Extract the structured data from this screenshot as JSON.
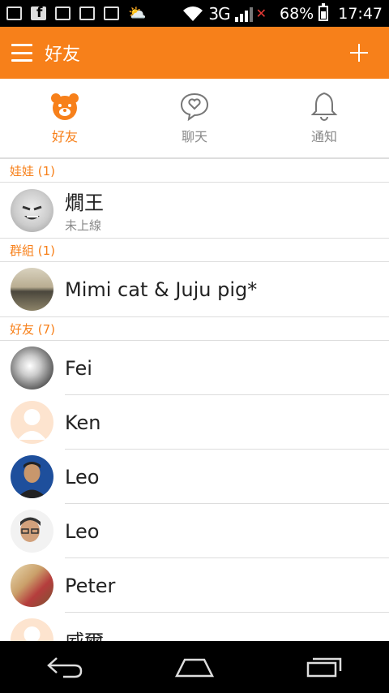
{
  "status_bar": {
    "network": "3G",
    "battery": "68%",
    "time": "17:47"
  },
  "app_bar": {
    "title": "好友"
  },
  "tabs": [
    {
      "label": "好友",
      "icon": "bear-icon",
      "active": true
    },
    {
      "label": "聊天",
      "icon": "chat-heart-icon",
      "active": false
    },
    {
      "label": "通知",
      "icon": "bell-icon",
      "active": false
    }
  ],
  "sections": {
    "babies": {
      "header": "娃娃 (1)",
      "items": [
        {
          "name": "燗王",
          "status": "未上線"
        }
      ]
    },
    "groups": {
      "header": "群組 (1)",
      "items": [
        {
          "name": "Mimi cat & Juju pig*"
        }
      ]
    },
    "friends": {
      "header": "好友 (7)",
      "items": [
        {
          "name": "Fei"
        },
        {
          "name": "Ken"
        },
        {
          "name": "Leo"
        },
        {
          "name": "Leo"
        },
        {
          "name": "Peter"
        },
        {
          "name": "威爾"
        }
      ]
    }
  },
  "colors": {
    "accent": "#f7801a",
    "divider": "#dddddd",
    "muted_text": "#888888"
  }
}
